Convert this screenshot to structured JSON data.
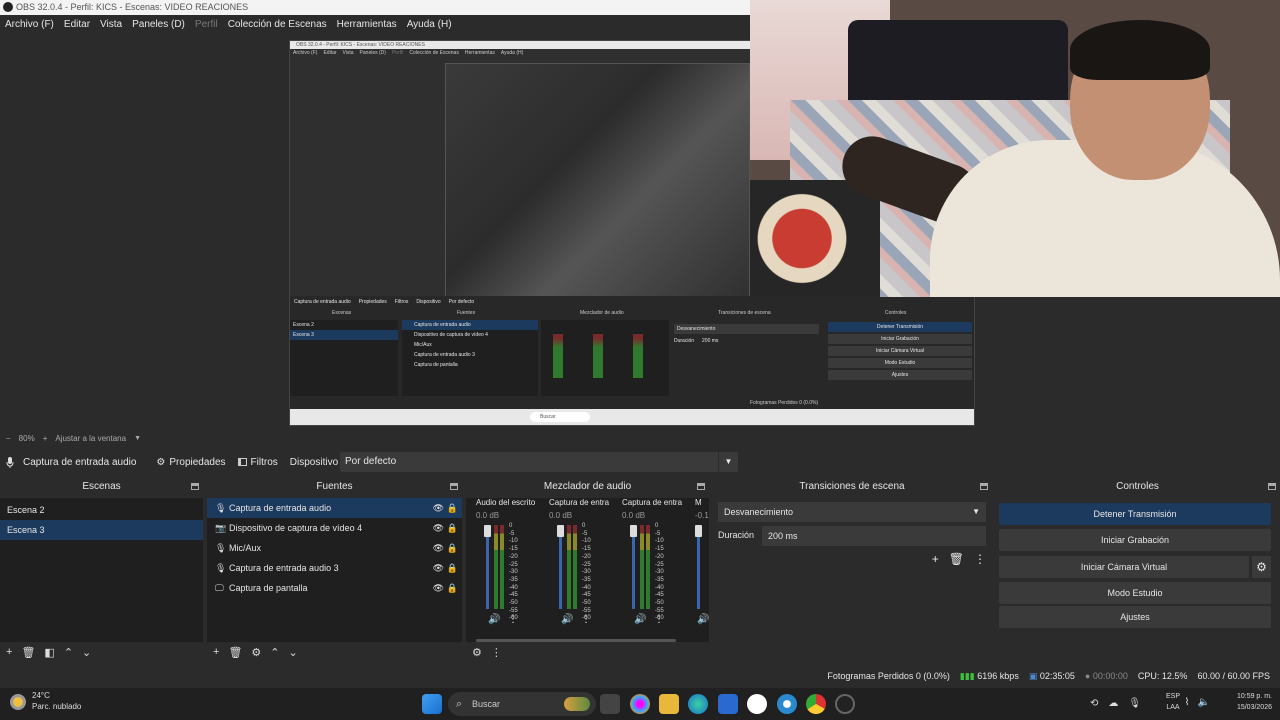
{
  "window": {
    "title": "OBS 32.0.4 - Perfil: KICS - Escenas: VIDEO REACIONES"
  },
  "menu": {
    "items": [
      {
        "label": "Archivo (F)",
        "enabled": true
      },
      {
        "label": "Editar",
        "enabled": true
      },
      {
        "label": "Vista",
        "enabled": true
      },
      {
        "label": "Paneles (D)",
        "enabled": true
      },
      {
        "label": "Perfil",
        "enabled": false
      },
      {
        "label": "Colección de Escenas",
        "enabled": true
      },
      {
        "label": "Herramientas",
        "enabled": true
      },
      {
        "label": "Ayuda (H)",
        "enabled": true
      }
    ]
  },
  "zoom": {
    "minus": "−",
    "value": "80%",
    "plus": "+",
    "fit_label": "Ajustar a la ventana"
  },
  "source_toolbar": {
    "source_name": "Captura de entrada audio",
    "properties_label": "Propiedades",
    "filters_label": "Filtros",
    "device_label": "Dispositivo",
    "device_value": "Por defecto"
  },
  "scenes": {
    "title": "Escenas",
    "items": [
      {
        "label": "Escena 2",
        "selected": false
      },
      {
        "label": "Escena 3",
        "selected": true
      }
    ]
  },
  "sources": {
    "title": "Fuentes",
    "items": [
      {
        "label": "Captura de entrada audio",
        "icon": "mic-icon",
        "selected": true
      },
      {
        "label": "Dispositivo de captura de vídeo 4",
        "icon": "camera-icon",
        "selected": false
      },
      {
        "label": "Mic/Aux",
        "icon": "mic-icon",
        "selected": false
      },
      {
        "label": "Captura de entrada audio 3",
        "icon": "mic-icon",
        "selected": false
      },
      {
        "label": "Captura de pantalla",
        "icon": "monitor-icon",
        "selected": false
      }
    ]
  },
  "mixer": {
    "title": "Mezclador de audio",
    "scale": [
      "0",
      "-5",
      "-10",
      "-15",
      "-20",
      "-25",
      "-30",
      "-35",
      "-40",
      "-45",
      "-50",
      "-55",
      "-60"
    ],
    "channels": [
      {
        "name": "Audio del escrito",
        "db": "0.0 dB"
      },
      {
        "name": "Captura de entra",
        "db": "0.0 dB"
      },
      {
        "name": "Captura de entra",
        "db": "0.0 dB"
      },
      {
        "name": "M",
        "db": "-0.1"
      }
    ]
  },
  "transitions": {
    "title": "Transiciones de escena",
    "selected": "Desvanecimiento",
    "duration_label": "Duración",
    "duration_value": "200 ms"
  },
  "controls": {
    "title": "Controles",
    "buttons": [
      {
        "label": "Detener Transmisión",
        "active": true
      },
      {
        "label": "Iniciar Grabación",
        "active": false
      },
      {
        "label": "Iniciar Cámara Virtual",
        "active": false
      },
      {
        "label": "Modo Estudio",
        "active": false
      },
      {
        "label": "Ajustes",
        "active": false
      }
    ]
  },
  "status": {
    "dropped_frames": "Fotogramas Perdidos 0 (0.0%)",
    "bitrate": "6196 kbps",
    "stream_time": "02:35:05",
    "rec_time": "00:00:00",
    "cpu": "CPU: 12.5%",
    "fps": "60.00 / 60.00 FPS"
  },
  "taskbar": {
    "weather_temp": "24°C",
    "weather_desc": "Parc. nublado",
    "search_placeholder": "Buscar",
    "lang_top": "ESP",
    "lang_bottom": "LAA",
    "time": "10:59 p. m.",
    "date": "15/03/2026"
  },
  "nested_preview": {
    "title": "OBS 32.0.4 - Perfil: KICS - Escenas: VIDEO REACIONES",
    "menu": [
      "Archivo (F)",
      "Editar",
      "Vista",
      "Paneles (D)",
      "Perfil",
      "Colección de Escenas",
      "Herramientas",
      "Ayuda (H)"
    ],
    "source_name": "Captura de entrada audio",
    "properties_label": "Propiedades",
    "filters_label": "Filtros",
    "device_label": "Dispositivo",
    "device_value": "Por defecto",
    "docks": [
      "Escenas",
      "Fuentes",
      "Mezclador de audio",
      "Transiciones de escena",
      "Controles"
    ],
    "scenes": [
      "Escena 2",
      "Escena 3"
    ],
    "sources": [
      "Captura de entrada audio",
      "Dispositivo de captura de vídeo 4",
      "Mic/Aux",
      "Captura de entrada audio 3",
      "Captura de pantalla"
    ],
    "transition": "Desvanecimiento",
    "duration_label": "Duración",
    "duration_value": "200 ms",
    "controls": [
      "Detener Transmisión",
      "Iniciar Grabación",
      "Iniciar Cámara Virtual",
      "Modo Estudio",
      "Ajustes"
    ],
    "status": "Fotogramas Perdidos 0 (0.0%)",
    "search_placeholder": "Buscar"
  },
  "colors": {
    "accent_selected": "#1c3a5e",
    "bg": "#2b2b2b",
    "panel": "#1f1f1f",
    "meter_green": "#2f7a2f",
    "fader_blue": "#3a66b0"
  }
}
